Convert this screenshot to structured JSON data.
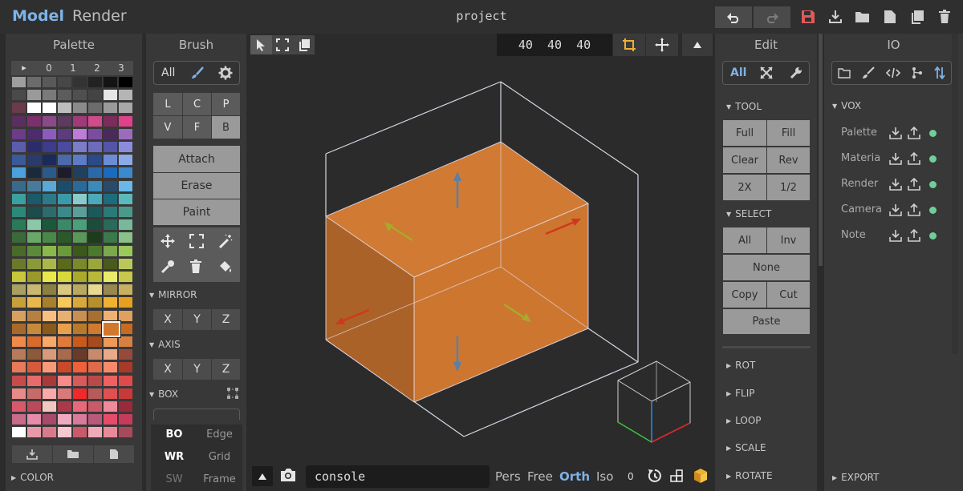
{
  "topbar": {
    "tab_model": "Model",
    "tab_render": "Render",
    "project": "project",
    "icons": [
      "undo-icon",
      "redo-icon",
      "save-icon",
      "download-icon",
      "folder-icon",
      "file-icon",
      "copy-icon",
      "trash-icon"
    ]
  },
  "palette": {
    "title": "Palette",
    "tabs": [
      "0",
      "1",
      "2",
      "3"
    ],
    "play": "▸",
    "color_label": "COLOR",
    "rows": [
      [
        "#9e9e9e",
        "#6b6b6b",
        "#595959",
        "#474747",
        "#333333",
        "#222222",
        "#141414",
        "#000000"
      ],
      [
        "#4a4a4a",
        "#9a9a9a",
        "#7a7a7a",
        "#5c5c5c",
        "#4f4f4f",
        "#444444",
        "#e6e6e6",
        "#b5b5b5"
      ],
      [
        "#6b3b4a",
        "#ffffff",
        "#ffffff",
        "#bdbdbd",
        "#8b8b8b",
        "#6c6c6c",
        "#9a9a9a",
        "#a8a8a8"
      ],
      [
        "#5b2e60",
        "#7b2f6b",
        "#8a4a8a",
        "#5d3a60",
        "#a23a7a",
        "#d14a8a",
        "#7c2c5a",
        "#e0428a"
      ],
      [
        "#6a3c8a",
        "#4c2c6c",
        "#8c5cbc",
        "#5c3c7c",
        "#bc7cd8",
        "#7c4ca0",
        "#4a2a5a",
        "#9c6cbc"
      ],
      [
        "#5c5cac",
        "#2c2c6c",
        "#3c3c8c",
        "#4a4aa0",
        "#7c7cc8",
        "#6c6cbc",
        "#5454a8",
        "#8c8cdc"
      ],
      [
        "#3a5a9a",
        "#2a3a6a",
        "#1a2a5a",
        "#4a6aaa",
        "#5c7cc8",
        "#2a4a8a",
        "#6c8cd8",
        "#8caae6"
      ],
      [
        "#4aa0dc",
        "#1a2a3a",
        "#2a5a8a",
        "#1c1c2c",
        "#204060",
        "#2a6aaa",
        "#1a6ac0",
        "#3a8ad0"
      ],
      [
        "#3a6a8a",
        "#4a7a9a",
        "#5aa8d8",
        "#1c4c6c",
        "#2a6a9a",
        "#3a8aba",
        "#2a4a6a",
        "#6ab8e8"
      ],
      [
        "#3aa0a0",
        "#1a5a6a",
        "#2a7a8a",
        "#3a9aaa",
        "#8acaca",
        "#4aaaba",
        "#1c6c7c",
        "#5ababa"
      ],
      [
        "#2a8a7a",
        "#1c4c4c",
        "#2c6c6c",
        "#3a8a8a",
        "#5aa09a",
        "#1a5a5a",
        "#2a7a7a",
        "#4a9a8a"
      ],
      [
        "#2a7a5a",
        "#8ac8a8",
        "#1a5a3a",
        "#3a8a6a",
        "#4aa07a",
        "#1c4c3c",
        "#2a6a5a",
        "#7ab89a"
      ],
      [
        "#3a6a3a",
        "#6aa86a",
        "#4a884a",
        "#2a5a2a",
        "#5a985a",
        "#1c3c1c",
        "#3a7a4a",
        "#8ac08a"
      ],
      [
        "#4a6a2a",
        "#5a8a3a",
        "#8ab84a",
        "#6a9a3a",
        "#3a5a1a",
        "#4a7a2a",
        "#7aa84a",
        "#9ac85a"
      ],
      [
        "#6a7a2a",
        "#8a9a3a",
        "#aab84a",
        "#5a6a1a",
        "#7a8a2a",
        "#9aa83a",
        "#4a5a1a",
        "#bac85a"
      ],
      [
        "#c8c83a",
        "#9a9a2a",
        "#e8e84a",
        "#d8d83a",
        "#aaaa2a",
        "#b8b83a",
        "#eaea6a",
        "#c8c84a"
      ],
      [
        "#a8a060",
        "#c8b870",
        "#8a8040",
        "#d8c880",
        "#b8a860",
        "#e8d890",
        "#988850",
        "#c8b060"
      ],
      [
        "#c8a03a",
        "#e8b84a",
        "#a8802a",
        "#f8c85a",
        "#d8a83a",
        "#b8902a",
        "#f0b030",
        "#e8a020"
      ],
      [
        "#d8a060",
        "#b88040",
        "#f8c080",
        "#e8b070",
        "#c89050",
        "#a87030",
        "#f0b070",
        "#e0a060"
      ],
      [
        "#a86a2a",
        "#c88a3a",
        "#8a5a1a",
        "#e8a04a",
        "#b87a2a",
        "#d07a30",
        "#6a4a1a",
        "#c86a20"
      ],
      [
        "#f08a4a",
        "#d86a2a",
        "#f8a868",
        "#e07a3a",
        "#c85a1a",
        "#a84a1a",
        "#f09858",
        "#d88040"
      ],
      [
        "#b87a5a",
        "#8a5a3a",
        "#d89a7a",
        "#a86a4a",
        "#6a3a2a",
        "#c88a6a",
        "#e8aa8a",
        "#984a3a"
      ],
      [
        "#e87a5a",
        "#d85a3a",
        "#f89a7a",
        "#c84a2a",
        "#f0603a",
        "#e06a4a",
        "#f88a6a",
        "#a83a2a"
      ],
      [
        "#c84a4a",
        "#e86a6a",
        "#a83a3a",
        "#f88a8a",
        "#d85a5a",
        "#b84a4a",
        "#f06060",
        "#e04a4a"
      ],
      [
        "#e88a8a",
        "#c86a6a",
        "#f8aaaa",
        "#d87a7a",
        "#f02a2a",
        "#b85a5a",
        "#e05050",
        "#c83a3a"
      ],
      [
        "#d85a6a",
        "#b84a5a",
        "#f0c8c0",
        "#a83a4a",
        "#e86a7a",
        "#c85a6a",
        "#f08a9a",
        "#982a3a"
      ],
      [
        "#c86a8a",
        "#e88aaa",
        "#a84a6a",
        "#f0aac0",
        "#d87a9a",
        "#b85a7a",
        "#e84a6a",
        "#c83a5a"
      ],
      [
        "#ffffff",
        "#e89aaa",
        "#d87a8a",
        "#f8c8d0",
        "#c85a6a",
        "#f0aab8",
        "#e88a9a",
        "#a84a5a"
      ]
    ],
    "selected": "#d2782d"
  },
  "brush": {
    "title": "Brush",
    "filter_all": "All",
    "grid_row1": [
      "L",
      "C",
      "P"
    ],
    "grid_row2": [
      "V",
      "F",
      "B"
    ],
    "modes": [
      "Attach",
      "Erase",
      "Paint"
    ],
    "mirror_label": "MIRROR",
    "mirror": [
      "X",
      "Y",
      "Z"
    ],
    "axis_label": "AXIS",
    "axis": [
      "X",
      "Y",
      "Z"
    ],
    "box_label": "BOX",
    "toggles": [
      [
        "BO",
        "Edge"
      ],
      [
        "WR",
        "Grid"
      ],
      [
        "SW",
        "Frame"
      ]
    ]
  },
  "viewport": {
    "dims": "40  40  40",
    "console": "console",
    "views": [
      "Pers",
      "Free",
      "Orth",
      "Iso"
    ],
    "frame": "0"
  },
  "edit": {
    "title": "Edit",
    "filter_all": "All",
    "tool_label": "TOOL",
    "tool": [
      [
        "Full",
        "Fill"
      ],
      [
        "Clear",
        "Rev"
      ],
      [
        "2X",
        "1/2"
      ]
    ],
    "select_label": "SELECT",
    "select_row1": [
      "All",
      "Inv"
    ],
    "select_none": "None",
    "select_row3": [
      "Copy",
      "Cut"
    ],
    "select_paste": "Paste",
    "collapsed": [
      "ROT",
      "FLIP",
      "LOOP",
      "SCALE",
      "ROTATE"
    ]
  },
  "io": {
    "title": "IO",
    "vox_label": "VOX",
    "rows": [
      "Palette",
      "Materia",
      "Render",
      "Camera",
      "Note"
    ],
    "export_label": "EXPORT"
  },
  "colors": {
    "accent": "#7fb2e6",
    "orange": "#d2782d",
    "save": "#e05a5a",
    "crop": "#f0b030",
    "dot": "#6ecf9b"
  }
}
